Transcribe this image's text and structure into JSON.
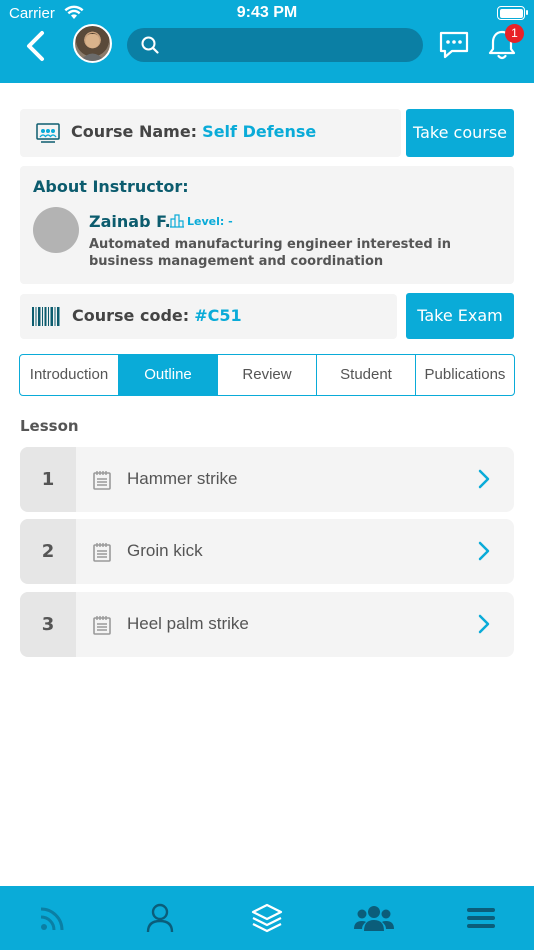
{
  "status_bar": {
    "carrier": "Carrier",
    "time": "9:43 PM"
  },
  "header": {
    "search": {
      "placeholder": "",
      "value": ""
    },
    "notifications": {
      "count": "1"
    }
  },
  "course": {
    "name_label": "Course Name:",
    "name_value": "Self Defense",
    "take_course_label": "Take course",
    "code_label": "Course code:",
    "code_value": "#C51",
    "take_exam_label": "Take Exam"
  },
  "instructor": {
    "section_title": "About Instructor:",
    "name": "Zainab F.",
    "level_label": "Level: -",
    "bio": "Automated manufacturing engineer interested in business management and coordination"
  },
  "tabs": [
    {
      "label": "Introduction",
      "active": false
    },
    {
      "label": "Outline",
      "active": true
    },
    {
      "label": "Review",
      "active": false
    },
    {
      "label": "Student",
      "active": false
    },
    {
      "label": "Publications",
      "active": false
    }
  ],
  "lessons": {
    "heading": "Lesson",
    "items": [
      {
        "number": "1",
        "title": "Hammer strike"
      },
      {
        "number": "2",
        "title": "Groin kick"
      },
      {
        "number": "3",
        "title": "Heel palm strike"
      }
    ]
  },
  "bottom_nav": {
    "items": [
      "feed-icon",
      "profile-icon",
      "courses-icon",
      "groups-icon",
      "menu-icon"
    ],
    "active": "courses-icon"
  },
  "colors": {
    "accent": "#0aabd8",
    "dark_teal": "#0c5c6e",
    "badge": "#e82127"
  }
}
